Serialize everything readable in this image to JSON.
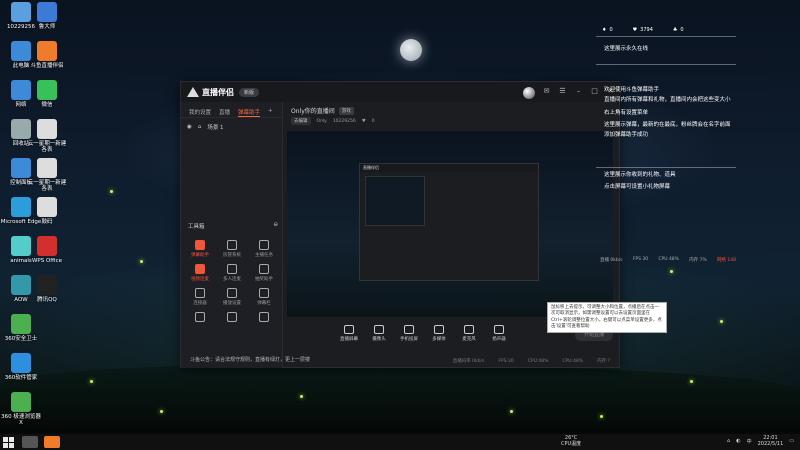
{
  "desktop": {
    "icons": [
      {
        "label": "10229256",
        "color": "#5aa0e0"
      },
      {
        "label": "此电脑",
        "color": "#3c8ad8"
      },
      {
        "label": "网络",
        "color": "#3c8ad8"
      },
      {
        "label": "回收站",
        "color": "#9aa"
      },
      {
        "label": "控制面板",
        "color": "#3c8ad8"
      },
      {
        "label": "Microsoft Edge",
        "color": "#2d9cdb"
      },
      {
        "label": "animals",
        "color": "#5cc"
      },
      {
        "label": "AOW",
        "color": "#39a"
      },
      {
        "label": "360安全卫士",
        "color": "#4caf50"
      },
      {
        "label": "360软件管家",
        "color": "#2d8fe0"
      },
      {
        "label": "360 极速浏览器X",
        "color": "#4caf50"
      }
    ],
    "icons_col2": [
      {
        "label": "鲁大师",
        "color": "#3d7ad8"
      },
      {
        "label": "斗鱼直播伴侣",
        "color": "#f07b2a"
      },
      {
        "label": "微信",
        "color": "#38c15a"
      },
      {
        "label": "云一星期一新建各表",
        "color": "#ddd"
      },
      {
        "label": "云一星期一新建各表",
        "color": "#ddd"
      },
      {
        "label": "鼓码",
        "color": "#ddd"
      },
      {
        "label": "WPS Office",
        "color": "#d32f2f"
      },
      {
        "label": "腾讯QQ",
        "color": "#222"
      }
    ]
  },
  "app": {
    "logo": "直播伴侣",
    "version": "新版",
    "left_tabs": [
      "我的设置",
      "直播",
      "弹幕助手"
    ],
    "active_tab": 2,
    "scene": "场景 1",
    "toolbox": "工具箱",
    "tools": [
      {
        "label": "弹幕助手",
        "red": true
      },
      {
        "label": "房管系统",
        "red": false
      },
      {
        "label": "主播任务",
        "red": false
      },
      {
        "label": "视频连麦",
        "red": true
      },
      {
        "label": "多人连麦",
        "red": false
      },
      {
        "label": "抽奖助手",
        "red": false
      },
      {
        "label": "连接器",
        "red": false
      },
      {
        "label": "播放设置",
        "red": false
      },
      {
        "label": "弹幕栏",
        "red": false
      },
      {
        "label": "",
        "red": false
      },
      {
        "label": "",
        "red": false
      },
      {
        "label": "",
        "red": false
      }
    ],
    "tip": "斗鱼公告：请合法规守规则，直播有绿灯，更上一层楼",
    "room_title": "Only你的直播间",
    "room_tag": "游戏",
    "room_edit": "去编辑",
    "room_id_label": "Only",
    "room_id": "10229256",
    "room_likes": "0",
    "controls": [
      "直播屏幕",
      "摄像头",
      "手机投屏",
      "多媒体",
      "麦克风",
      "扬声器"
    ],
    "start_label": "开始直播",
    "status": [
      "直播码率 0kb/s",
      "FPS:30",
      "CPU:48%",
      "CPU:48%",
      "内存:?"
    ]
  },
  "tooltip": "鼠标移上去提示，可调整大小和位置，点播后在点击一次可取消显示，如需调整设置可以去设置页面里在Ctrl+滚轮调整位置大小。右键可以点菜单设置更多，点击'设置'可查看帮助",
  "right_panel": {
    "top_counts": [
      "0",
      "3794",
      "0"
    ],
    "lines": [
      "这里展示永久在线",
      "欢迎使用斗鱼弹幕助手",
      "直播间内所有弹幕和礼物，直播间内会把这些变大小",
      "右上角有设置菜单",
      "这里展示弹幕，最新的在最底，粉丝牌会在名字前面",
      "添加弹幕助手成功",
      "这里展示你收到的礼物、道具",
      "点击屏幕可设置小礼物屏幕"
    ],
    "stats": [
      "直播 0kb/s",
      "FPS 30",
      "CPU 48%",
      "内存 7%",
      "网络 148"
    ]
  },
  "taskbar": {
    "weather_temp": "26°C",
    "weather_desc": "CPU温度",
    "time": "22:01",
    "date": "2022/5/11"
  }
}
